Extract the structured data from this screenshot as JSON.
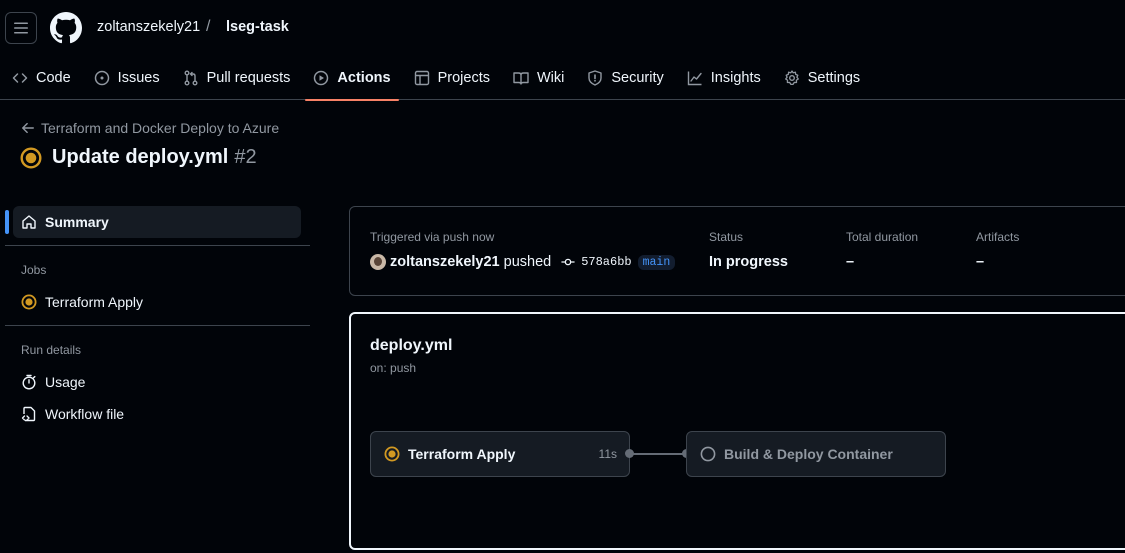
{
  "header": {
    "owner": "zoltanszekely21",
    "separator": "/",
    "repo": "lseg-task"
  },
  "tabs": [
    {
      "label": "Code",
      "icon": "code-icon",
      "active": false
    },
    {
      "label": "Issues",
      "icon": "issue-icon",
      "active": false
    },
    {
      "label": "Pull requests",
      "icon": "pull-request-icon",
      "active": false
    },
    {
      "label": "Actions",
      "icon": "play-icon",
      "active": true
    },
    {
      "label": "Projects",
      "icon": "table-icon",
      "active": false
    },
    {
      "label": "Wiki",
      "icon": "book-icon",
      "active": false
    },
    {
      "label": "Security",
      "icon": "shield-icon",
      "active": false
    },
    {
      "label": "Insights",
      "icon": "graph-icon",
      "active": false
    },
    {
      "label": "Settings",
      "icon": "gear-icon",
      "active": false
    }
  ],
  "run": {
    "workflow_link": "Terraform and Docker Deploy to Azure",
    "title": "Update deploy.yml",
    "number": "#2"
  },
  "sidebar": {
    "summary": "Summary",
    "jobs_heading": "Jobs",
    "job": "Terraform Apply",
    "run_details_heading": "Run details",
    "usage": "Usage",
    "workflow_file": "Workflow file"
  },
  "summary": {
    "triggered_label": "Triggered via push now",
    "actor": "zoltanszekely21",
    "pushed": "pushed",
    "commit": "578a6bb",
    "branch": "main",
    "status_label": "Status",
    "status_value": "In progress",
    "duration_label": "Total duration",
    "duration_value": "–",
    "artifacts_label": "Artifacts",
    "artifacts_value": "–"
  },
  "graph": {
    "workflow_file": "deploy.yml",
    "trigger": "on: push",
    "jobs": [
      {
        "label": "Terraform Apply",
        "time": "11s",
        "status": "in_progress"
      },
      {
        "label": "Build & Deploy Container",
        "time": "",
        "status": "pending"
      }
    ]
  },
  "colors": {
    "background": "#010409",
    "in_progress": "#d29922",
    "accent_tab": "#f78166",
    "link_blue": "#4493f8"
  }
}
